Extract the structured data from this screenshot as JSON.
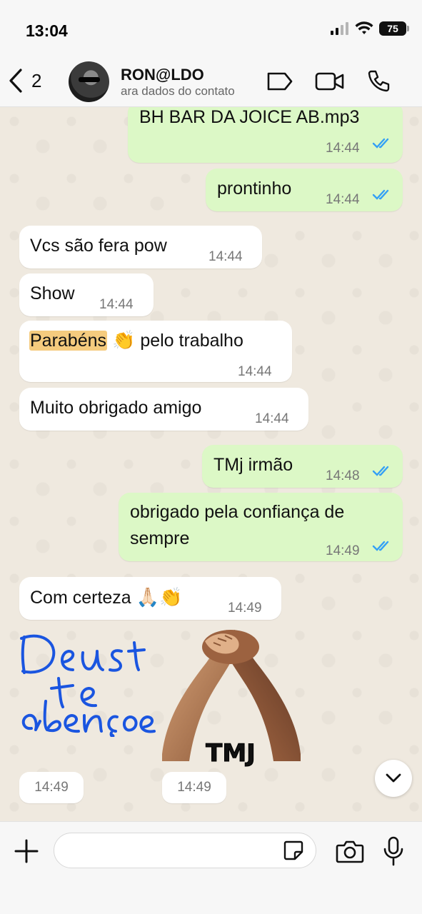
{
  "status_bar": {
    "time": "13:04",
    "battery": "75"
  },
  "header": {
    "back_count": "2",
    "contact_name": "RON@LDO",
    "contact_subtitle": "ara dados do contato"
  },
  "messages": [
    {
      "direction": "out",
      "text": "BH BAR DA JOICE AB.mp3",
      "time": "14:44",
      "read": true
    },
    {
      "direction": "out",
      "text": "prontinho",
      "time": "14:44",
      "read": true
    },
    {
      "direction": "in",
      "text": "Vcs são fera pow",
      "time": "14:44"
    },
    {
      "direction": "in",
      "text": "Show",
      "time": "14:44"
    },
    {
      "direction": "in",
      "highlight": "Parabéns",
      "emoji": "👏",
      "text_after": "pelo trabalho",
      "time": "14:44"
    },
    {
      "direction": "in",
      "text": "Muito obrigado amigo",
      "time": "14:44"
    },
    {
      "direction": "out",
      "text": "TMj irmão",
      "time": "14:48",
      "read": true
    },
    {
      "direction": "out",
      "line1": "obrigado pela confiança de",
      "line2": "sempre",
      "time": "14:49",
      "read": true
    },
    {
      "direction": "in",
      "text": "Com certeza",
      "emoji": "🙏🏻👏",
      "time": "14:49"
    }
  ],
  "stickers": [
    {
      "name": "handwritten-blessing",
      "text": "Deus te abençoe",
      "time": "14:49"
    },
    {
      "name": "handshake-tmj",
      "text": "TMJ",
      "time": "14:49"
    }
  ],
  "colors": {
    "outgoing_bubble": "#dcf8c6",
    "incoming_bubble": "#ffffff",
    "read_ticks": "#34a0f5",
    "highlight": "#f5cb7e",
    "handwriting": "#1a55e0"
  }
}
